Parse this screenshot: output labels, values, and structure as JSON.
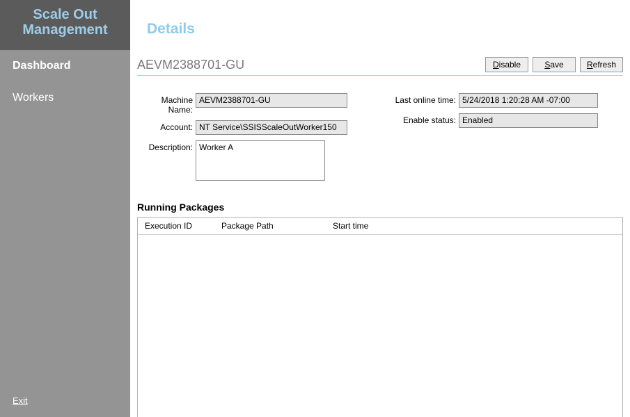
{
  "sidebar": {
    "title_line1": "Scale Out",
    "title_line2": "Management",
    "items": [
      {
        "label": "Dashboard"
      },
      {
        "label": "Workers"
      }
    ],
    "exit_prefix": "E",
    "exit_rest": "xit"
  },
  "header": {
    "title": "Details"
  },
  "subheader": {
    "machine": "AEVM2388701-GU",
    "buttons": {
      "disable_mn": "D",
      "disable_rest": "isable",
      "save_mn": "S",
      "save_rest": "ave",
      "refresh_mn": "R",
      "refresh_rest": "efresh"
    }
  },
  "form": {
    "labels": {
      "machine_name": "Machine Name:",
      "account": "Account:",
      "description": "Description:",
      "last_online": "Last online time:",
      "enable_status": "Enable status:"
    },
    "values": {
      "machine_name": "AEVM2388701-GU",
      "account": "NT Service\\SSISScaleOutWorker150",
      "description": "Worker A",
      "last_online": "5/24/2018 1:20:28 AM -07:00",
      "enable_status": "Enabled"
    }
  },
  "running_packages": {
    "title": "Running Packages",
    "columns": {
      "execution_id": "Execution ID",
      "package_path": "Package Path",
      "start_time": "Start time"
    }
  }
}
